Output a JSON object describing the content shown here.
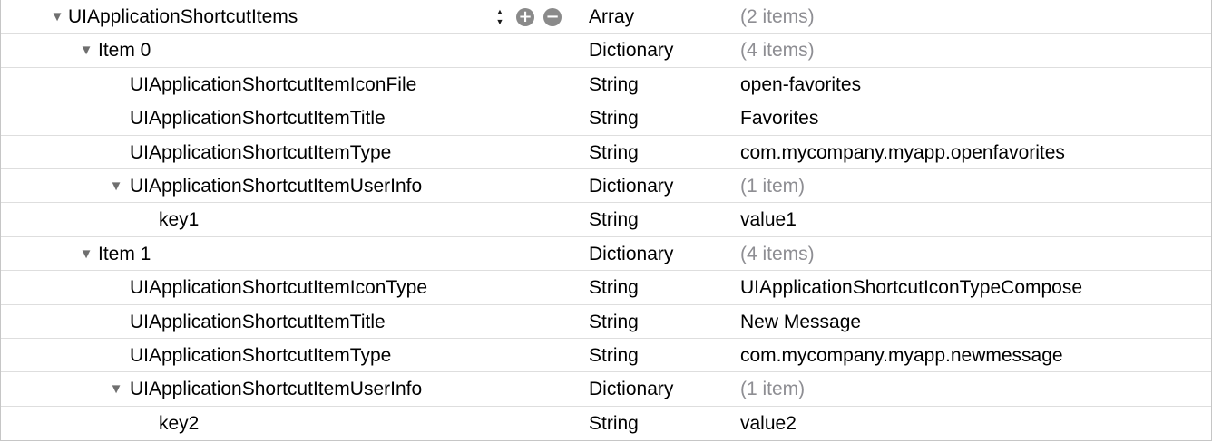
{
  "rows": [
    {
      "level": 0,
      "disclosure": "▼",
      "key": "UIApplicationShortcutItems",
      "type": "Array",
      "value": "(2 items)",
      "muted": true,
      "controls": true
    },
    {
      "level": 1,
      "disclosure": "▼",
      "key": "Item 0",
      "type": "Dictionary",
      "value": "(4 items)",
      "muted": true
    },
    {
      "level": 2,
      "disclosure": "",
      "key": "UIApplicationShortcutItemIconFile",
      "type": "String",
      "value": "open-favorites",
      "muted": false
    },
    {
      "level": 2,
      "disclosure": "",
      "key": "UIApplicationShortcutItemTitle",
      "type": "String",
      "value": "Favorites",
      "muted": false
    },
    {
      "level": 2,
      "disclosure": "",
      "key": "UIApplicationShortcutItemType",
      "type": "String",
      "value": "com.mycompany.myapp.openfavorites",
      "muted": false
    },
    {
      "level": 2,
      "disclosure": "▼",
      "key": "UIApplicationShortcutItemUserInfo",
      "type": "Dictionary",
      "value": "(1 item)",
      "muted": true
    },
    {
      "level": 3,
      "disclosure": "",
      "key": "key1",
      "type": "String",
      "value": "value1",
      "muted": false
    },
    {
      "level": 1,
      "disclosure": "▼",
      "key": "Item 1",
      "type": "Dictionary",
      "value": "(4 items)",
      "muted": true
    },
    {
      "level": 2,
      "disclosure": "",
      "key": "UIApplicationShortcutItemIconType",
      "type": "String",
      "value": "UIApplicationShortcutIconTypeCompose",
      "muted": false
    },
    {
      "level": 2,
      "disclosure": "",
      "key": "UIApplicationShortcutItemTitle",
      "type": "String",
      "value": "New Message",
      "muted": false
    },
    {
      "level": 2,
      "disclosure": "",
      "key": "UIApplicationShortcutItemType",
      "type": "String",
      "value": "com.mycompany.myapp.newmessage",
      "muted": false
    },
    {
      "level": 2,
      "disclosure": "▼",
      "key": "UIApplicationShortcutItemUserInfo",
      "type": "Dictionary",
      "value": "(1 item)",
      "muted": true
    },
    {
      "level": 3,
      "disclosure": "",
      "key": "key2",
      "type": "String",
      "value": "value2",
      "muted": false
    }
  ],
  "controls": {
    "stepper_up": "▲",
    "stepper_down": "▼",
    "add_symbol": "+",
    "remove_symbol": "−",
    "add_icon": "plus-circle-icon",
    "remove_icon": "minus-circle-icon"
  },
  "colors": {
    "muted_value": "#8e8e93",
    "row_divider": "#dedede",
    "control_gray": "#8a8a8a"
  }
}
